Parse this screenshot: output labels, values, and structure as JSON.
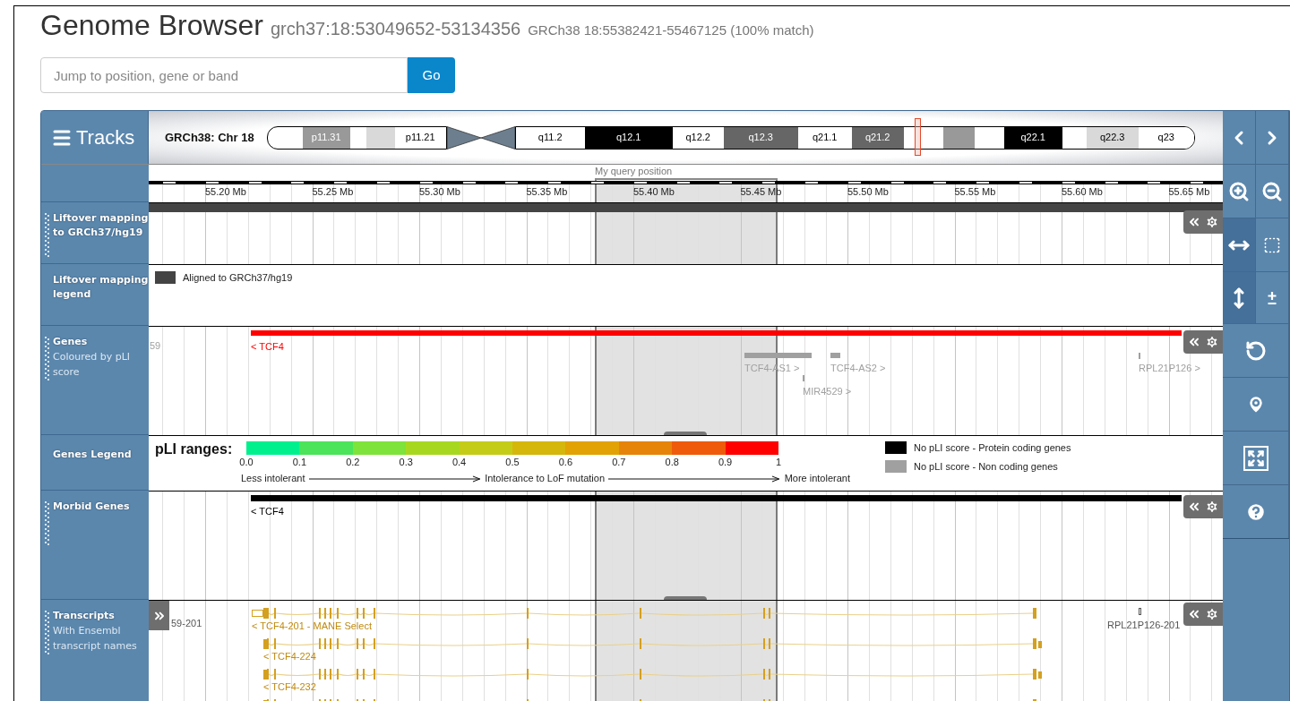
{
  "header": {
    "title": "Genome Browser",
    "position": "grch37:18:53049652-53134356",
    "mapping": "GRCh38 18:55382421-55467125 (100% match)"
  },
  "search": {
    "placeholder": "Jump to position, gene or band",
    "button": "Go"
  },
  "tracks_button": "Tracks",
  "chromosome": {
    "label": "GRCh38: Chr 18",
    "p_bands": [
      {
        "name": "p11.31",
        "color": "#999999"
      },
      {
        "color": "#d9d9d9"
      },
      {
        "name": "p11.21",
        "color": "#ffffff"
      }
    ],
    "q_bands": [
      {
        "name": "q11.2",
        "color": "#ffffff"
      },
      {
        "name": "q12.1",
        "color": "#000000"
      },
      {
        "name": "q12.2",
        "color": "#ffffff"
      },
      {
        "name": "q12.3",
        "color": "#666666"
      },
      {
        "name": "q21.1",
        "color": "#ffffff"
      },
      {
        "name": "q21.2",
        "color": "#666666"
      },
      {
        "color": "#999999"
      },
      {
        "name": "q22.1",
        "color": "#000000"
      },
      {
        "name": "q22.3",
        "color": "#d9d9d9"
      },
      {
        "name": "q23",
        "color": "#ffffff"
      }
    ]
  },
  "query_label": "My query position",
  "ruler": [
    "55.20 Mb",
    "55.25 Mb",
    "55.30 Mb",
    "55.35 Mb",
    "55.40 Mb",
    "55.45 Mb",
    "55.50 Mb",
    "55.55 Mb",
    "55.60 Mb",
    "55.65 Mb"
  ],
  "tracks": [
    {
      "kind": "liftover",
      "title": "Liftover mapping to GRCh37/hg19"
    },
    {
      "kind": "legend",
      "title": "Liftover mapping legend",
      "items": [
        {
          "label": "Aligned to GRCh37/hg19",
          "color": "#444444"
        }
      ]
    },
    {
      "kind": "genes",
      "title": "Genes",
      "subtitle": "Coloured by pLI score",
      "features": [
        {
          "kind": "offscreen",
          "label": "59",
          "color": "#a0a0a0"
        },
        {
          "kind": "bar",
          "label": "< TCF4",
          "color": "#ff0000"
        },
        {
          "kind": "bar",
          "label": "TCF4-AS1 >",
          "color": "#a0a0a0"
        },
        {
          "kind": "bar",
          "label": "TCF4-AS2 >",
          "color": "#a0a0a0"
        },
        {
          "kind": "tick",
          "label": "MIR4529 >",
          "color": "#a0a0a0"
        },
        {
          "kind": "tick",
          "label": "RPL21P126 >",
          "color": "#a0a0a0"
        }
      ]
    },
    {
      "kind": "pli_legend",
      "title": "Genes Legend",
      "heading": "pLI ranges:",
      "scale": [
        {
          "color": "#00f08e"
        },
        {
          "color": "#4be45a"
        },
        {
          "color": "#7ee33a"
        },
        {
          "color": "#a7d81f"
        },
        {
          "color": "#c5cc18"
        },
        {
          "color": "#d5b70c"
        },
        {
          "color": "#e2a204"
        },
        {
          "color": "#e6840a"
        },
        {
          "color": "#ef5a0a"
        },
        {
          "color": "#ff0000"
        }
      ],
      "ticks": [
        "0.0",
        "0.1",
        "0.2",
        "0.3",
        "0.4",
        "0.5",
        "0.6",
        "0.7",
        "0.8",
        "0.9",
        "1"
      ],
      "axis": [
        "Less intolerant",
        "Intolerance to LoF mutation",
        "More intolerant"
      ],
      "items": [
        {
          "label": "No pLI score - Protein coding genes",
          "color": "#000000"
        },
        {
          "label": "No pLI score - Non coding genes",
          "color": "#a0a0a0"
        }
      ]
    },
    {
      "kind": "genes",
      "title": "Morbid Genes",
      "features": [
        {
          "kind": "bar",
          "label": "< TCF4",
          "color": "#000000"
        }
      ]
    },
    {
      "kind": "transcripts",
      "title": "Transcripts",
      "subtitle": "With Ensembl transcript names",
      "features": [
        {
          "kind": "offscreen",
          "label": "59-201"
        },
        {
          "kind": "mane",
          "label": "< TCF4-201 - MANE Select"
        },
        {
          "kind": "transcript",
          "label": "< TCF4-224"
        },
        {
          "kind": "transcript",
          "label": "< TCF4-232"
        },
        {
          "kind": "transcript"
        },
        {
          "kind": "pseudogene",
          "label": "RPL21P126-201"
        }
      ]
    }
  ],
  "mode_buttons": [
    {
      "selected": true
    },
    {
      "selected": false
    },
    {
      "selected": true
    },
    {
      "selected": false
    }
  ]
}
